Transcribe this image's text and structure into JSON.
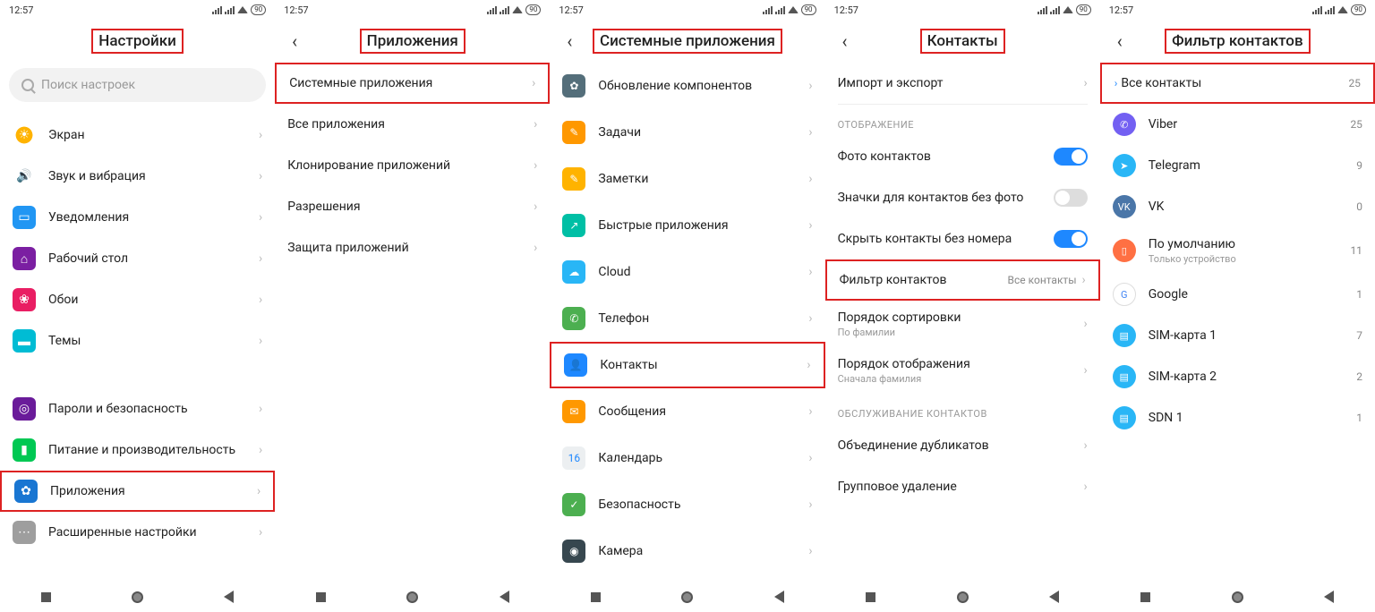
{
  "status": {
    "time": "12:57",
    "battery": "90"
  },
  "s1": {
    "title": "Настройки",
    "search_placeholder": "Поиск настроек",
    "items": [
      {
        "label": "Экран"
      },
      {
        "label": "Звук и вибрация"
      },
      {
        "label": "Уведомления"
      },
      {
        "label": "Рабочий стол"
      },
      {
        "label": "Обои"
      },
      {
        "label": "Темы"
      }
    ],
    "items2": [
      {
        "label": "Пароли и безопасность"
      },
      {
        "label": "Питание и производительность"
      },
      {
        "label": "Приложения"
      },
      {
        "label": "Расширенные настройки"
      }
    ]
  },
  "s2": {
    "title": "Приложения",
    "items": [
      {
        "label": "Системные приложения"
      },
      {
        "label": "Все приложения"
      },
      {
        "label": "Клонирование приложений"
      },
      {
        "label": "Разрешения"
      },
      {
        "label": "Защита приложений"
      }
    ]
  },
  "s3": {
    "title": "Системные приложения",
    "items": [
      {
        "label": "Обновление компонентов",
        "color": "#546e7a",
        "glyph": "✿"
      },
      {
        "label": "Задачи",
        "color": "#ff9800",
        "glyph": "✎"
      },
      {
        "label": "Заметки",
        "color": "#ffb300",
        "glyph": "✎"
      },
      {
        "label": "Быстрые приложения",
        "color": "#00bfa5",
        "glyph": "↗"
      },
      {
        "label": "Cloud",
        "color": "#29b6f6",
        "glyph": "☁"
      },
      {
        "label": "Телефон",
        "color": "#4caf50",
        "glyph": "✆"
      },
      {
        "label": "Контакты",
        "color": "#1e88ff",
        "glyph": "👤"
      },
      {
        "label": "Сообщения",
        "color": "#ff9800",
        "glyph": "✉"
      },
      {
        "label": "Календарь",
        "color": "#eceff1",
        "glyph": "16"
      },
      {
        "label": "Безопасность",
        "color": "#4caf50",
        "glyph": "✓"
      },
      {
        "label": "Камера",
        "color": "#37474f",
        "glyph": "◉"
      }
    ]
  },
  "s4": {
    "title": "Контакты",
    "top": {
      "label": "Импорт и экспорт"
    },
    "section1": "ОТОБРАЖЕНИЕ",
    "display_items": [
      {
        "label": "Фото контактов",
        "toggle": "on"
      },
      {
        "label": "Значки для контактов без фото",
        "toggle": "off"
      },
      {
        "label": "Скрыть контакты без номера",
        "toggle": "on"
      }
    ],
    "filter": {
      "label": "Фильтр контактов",
      "value": "Все контакты"
    },
    "sort": {
      "label": "Порядок сортировки",
      "sub": "По фамилии"
    },
    "order": {
      "label": "Порядок отображения",
      "sub": "Сначала фамилия"
    },
    "section2": "ОБСЛУЖИВАНИЕ КОНТАКТОВ",
    "maint": [
      {
        "label": "Объединение дубликатов"
      },
      {
        "label": "Групповое удаление"
      }
    ]
  },
  "s5": {
    "title": "Фильтр контактов",
    "items": [
      {
        "label": "Все контакты",
        "count": "25",
        "color": "",
        "glyph": ""
      },
      {
        "label": "Viber",
        "count": "25",
        "color": "#7360f2",
        "glyph": "✆"
      },
      {
        "label": "Telegram",
        "count": "9",
        "color": "#29b6f6",
        "glyph": "➤"
      },
      {
        "label": "VK",
        "count": "0",
        "color": "#4a76a8",
        "glyph": "VK"
      },
      {
        "label": "По умолчанию",
        "sub": "Только устройство",
        "count": "11",
        "color": "#ff7043",
        "glyph": "▯"
      },
      {
        "label": "Google",
        "count": "1",
        "color": "#fff",
        "glyph": "G"
      },
      {
        "label": "SIM-карта 1",
        "count": "7",
        "color": "#29b6f6",
        "glyph": "▤"
      },
      {
        "label": "SIM-карта 2",
        "count": "2",
        "color": "#29b6f6",
        "glyph": "▤"
      },
      {
        "label": "SDN 1",
        "count": "1",
        "color": "#29b6f6",
        "glyph": "▤"
      }
    ]
  }
}
